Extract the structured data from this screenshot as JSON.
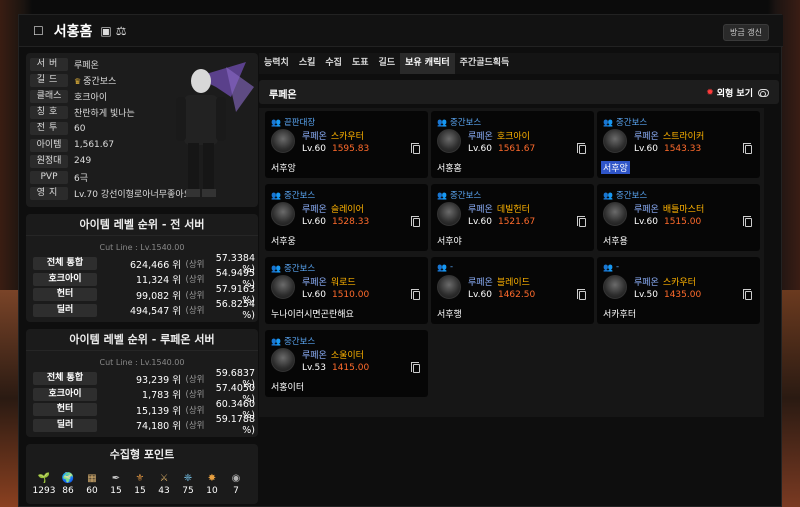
{
  "header": {
    "title": "서홍홈",
    "refresh_label": "방금 갱신"
  },
  "profile": {
    "rows": [
      {
        "label": "서버",
        "value": "루페온"
      },
      {
        "label": "길드",
        "value": "중간보스",
        "crown": true
      },
      {
        "label": "클래스",
        "value": "호크아이"
      },
      {
        "label": "칭호",
        "value": "찬란하게 빛나는"
      },
      {
        "label": "전투",
        "value": "60"
      },
      {
        "label": "아이템",
        "value": "1,561.67"
      },
      {
        "label": "원정대",
        "value": "249"
      },
      {
        "label": "PVP",
        "value": "6극"
      },
      {
        "label": "영지",
        "value": "Lv.70 강선이형로아너무좋아요"
      }
    ]
  },
  "rank_all": {
    "title": "아이템 레벨 순위 - 전 서버",
    "cutline": "Cut Line : Lv.1540.00",
    "rows": [
      {
        "label": "전체 통합",
        "value": "624,466 위",
        "sub": "(상위",
        "pct": "57.3384 %)"
      },
      {
        "label": "호크아이",
        "value": "11,324 위",
        "sub": "(상위",
        "pct": "54.9495 %)"
      },
      {
        "label": "헌터",
        "value": "99,082 위",
        "sub": "(상위",
        "pct": "57.9163 %)"
      },
      {
        "label": "딜러",
        "value": "494,547 위",
        "sub": "(상위",
        "pct": "56.8254 %)"
      }
    ]
  },
  "rank_server": {
    "title": "아이템 레벨 순위 - 루페온 서버",
    "cutline": "Cut Line : Lv.1540.00",
    "rows": [
      {
        "label": "전체 통합",
        "value": "93,239 위",
        "sub": "(상위",
        "pct": "59.6837 %)"
      },
      {
        "label": "호크아이",
        "value": "1,783 위",
        "sub": "(상위",
        "pct": "57.4050 %)"
      },
      {
        "label": "헌터",
        "value": "15,139 위",
        "sub": "(상위",
        "pct": "60.3460 %)"
      },
      {
        "label": "딜러",
        "value": "74,180 위",
        "sub": "(상위",
        "pct": "59.1788 %)"
      }
    ]
  },
  "collect": {
    "title": "수집형 포인트",
    "items": [
      {
        "icon": "mokoko-seed-icon",
        "glyph": "🌱",
        "value": "1293"
      },
      {
        "icon": "island-heart-icon",
        "glyph": "🌍",
        "value": "86"
      },
      {
        "icon": "giant-heart-icon",
        "glyph": "▦",
        "value": "60"
      },
      {
        "icon": "art-icon",
        "glyph": "✒",
        "value": "15"
      },
      {
        "icon": "ignea-token-icon",
        "glyph": "⚜",
        "value": "15"
      },
      {
        "icon": "orpheus-star-icon",
        "glyph": "⚔",
        "value": "43"
      },
      {
        "icon": "world-tree-leaf-icon",
        "glyph": "❈",
        "value": "75"
      },
      {
        "icon": "sea-bounty-icon",
        "glyph": "✸",
        "value": "10"
      },
      {
        "icon": "masterpiece-icon",
        "glyph": "◉",
        "value": "7"
      }
    ]
  },
  "tabs": [
    "능력치",
    "스킬",
    "수집",
    "도표",
    "길드",
    "보유 캐릭터",
    "주간골드획득"
  ],
  "active_tab": 5,
  "server_bar": {
    "name": "루페온",
    "toggle_label": "외형 보기"
  },
  "characters": [
    {
      "role": "끝판대장",
      "server": "루페온",
      "class": "스카우터",
      "level": "Lv.60",
      "ilvl": "1595.83",
      "name": "서후앙",
      "highlight": false
    },
    {
      "role": "중간보스",
      "server": "루페온",
      "class": "호크아이",
      "level": "Lv.60",
      "ilvl": "1561.67",
      "name": "서홍홈",
      "highlight": false
    },
    {
      "role": "중간보스",
      "server": "루페온",
      "class": "스트라이커",
      "level": "Lv.60",
      "ilvl": "1543.33",
      "name": "서후앙",
      "highlight": true
    },
    {
      "role": "중간보스",
      "server": "루페온",
      "class": "슬레이어",
      "level": "Lv.60",
      "ilvl": "1528.33",
      "name": "서후웅",
      "highlight": false
    },
    {
      "role": "중간보스",
      "server": "루페온",
      "class": "데빌헌터",
      "level": "Lv.60",
      "ilvl": "1521.67",
      "name": "서후야",
      "highlight": false
    },
    {
      "role": "중간보스",
      "server": "루페온",
      "class": "배틀마스터",
      "level": "Lv.60",
      "ilvl": "1515.00",
      "name": "서후용",
      "highlight": false
    },
    {
      "role": "중간보스",
      "server": "루페온",
      "class": "워로드",
      "level": "Lv.60",
      "ilvl": "1510.00",
      "name": "누나이러시면곤란해요",
      "highlight": false
    },
    {
      "role": "-",
      "server": "루페온",
      "class": "블레이드",
      "level": "Lv.60",
      "ilvl": "1462.50",
      "name": "서후행",
      "highlight": false
    },
    {
      "role": "-",
      "server": "루페온",
      "class": "스카우터",
      "level": "Lv.50",
      "ilvl": "1435.00",
      "name": "서카후터",
      "highlight": false
    },
    {
      "role": "중간보스",
      "server": "루페온",
      "class": "소울이터",
      "level": "Lv.53",
      "ilvl": "1415.00",
      "name": "서홍이터",
      "highlight": false
    }
  ]
}
